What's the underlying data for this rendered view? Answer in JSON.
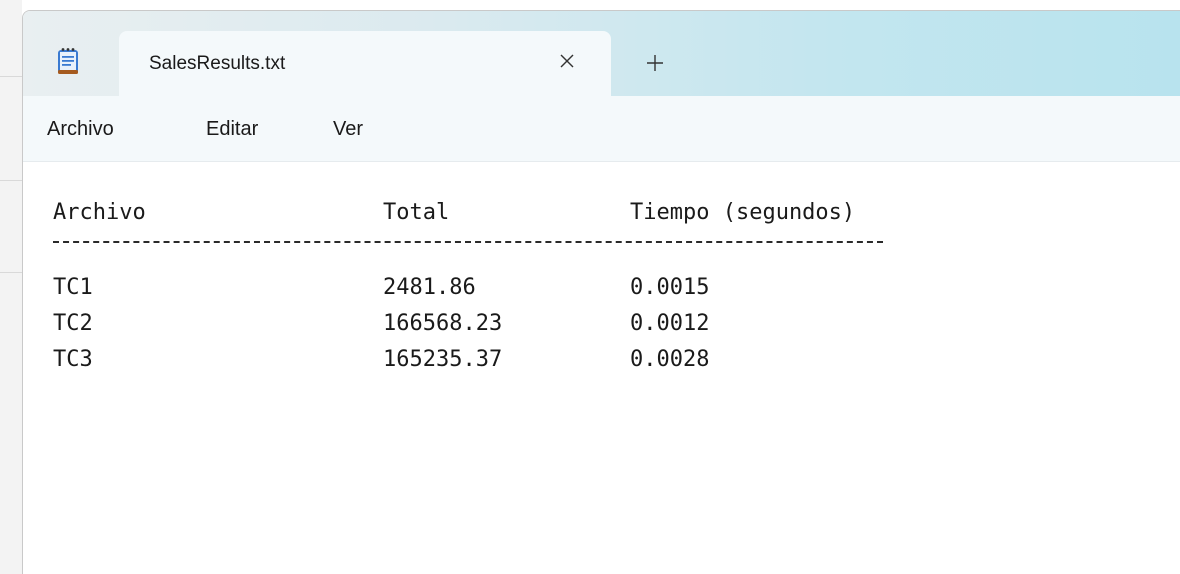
{
  "window": {
    "tab_title": "SalesResults.txt",
    "app_icon": "notepad-icon",
    "close_icon": "close-icon",
    "new_tab_icon": "plus-icon"
  },
  "menu": {
    "items": [
      "Archivo",
      "Editar",
      "Ver"
    ]
  },
  "document": {
    "headers": [
      "Archivo",
      "Total",
      "Tiempo (segundos)"
    ],
    "separator": "--------------------------------------------",
    "rows": [
      [
        "TC1",
        "2481.86",
        "0.0015"
      ],
      [
        "TC2",
        "166568.23",
        "0.0012"
      ],
      [
        "TC3",
        "165235.37",
        "0.0028"
      ]
    ]
  },
  "colors": {
    "titlebar_start": "#e9eff1",
    "titlebar_end": "#b8e3ee",
    "tab_bg": "#f4f9fb",
    "text": "#1a1a1a"
  }
}
